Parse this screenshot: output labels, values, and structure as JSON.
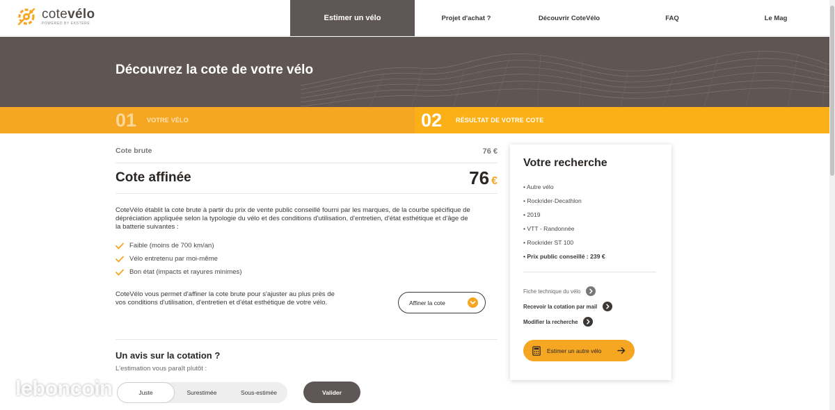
{
  "brand": {
    "name_light": "cote",
    "name_bold": "vélo",
    "powered_by": "powered by ekstere"
  },
  "nav": {
    "items": [
      {
        "label": "Estimer un vélo",
        "active": true
      },
      {
        "label": "Projet d'achat ?",
        "active": false
      },
      {
        "label": "Découvrir CoteVélo",
        "active": false
      },
      {
        "label": "FAQ",
        "active": false
      },
      {
        "label": "Le Mag",
        "active": false
      }
    ]
  },
  "hero": {
    "title": "Découvrez la cote de votre vélo"
  },
  "steps": [
    {
      "number": "01",
      "label": "VOTRE VÉLO"
    },
    {
      "number": "02",
      "label": "RÉSULTAT DE VOTRE COTE"
    }
  ],
  "result": {
    "brute_label": "Cote brute",
    "brute_value": "76 €",
    "affinee_label": "Cote affinée",
    "affinee_value": "76",
    "currency": "€",
    "description": "CoteVélo établit la cote brute à partir du prix de vente public conseillé fourni par les marques, de la courbe spécifique de dépréciation appliquée selon la typologie du vélo et des conditions d'utilisation, d'entretien, d'état esthétique et d'âge de la batterie suivantes :",
    "conditions": [
      "Faible (moins de 700 km/an)",
      "Vélo entretenu par moi-même",
      "Bon état (impacts et rayures minimes)"
    ],
    "affiner_text": "CoteVélo vous permet d'affiner la cote brute pour s'ajuster au plus près de vos conditions d'utilisation, d'entretien et d'état esthétique de votre vélo.",
    "affiner_button": "Affiner la cote"
  },
  "avis": {
    "title": "Un avis sur la cotation ?",
    "subtitle": "L'estimation vous paraît plutôt :",
    "options": [
      "Juste",
      "Surestimée",
      "Sous-estimée"
    ],
    "selected": "Juste",
    "submit": "Valider"
  },
  "search": {
    "title": "Votre recherche",
    "items": [
      "• Autre vélo",
      "• Rockrider-Decathlon",
      "• 2019",
      "• VTT - Randonnée",
      "• Rockrider ST 100",
      "• Prix public conseillé : 239 €"
    ],
    "links": [
      "Fiche technique du vélo",
      "Recevoir la cotation par mail",
      "Modifier la recherche"
    ],
    "cta": "Estimer un autre vélo"
  },
  "watermark": "leboncoin",
  "colors": {
    "accent": "#f5a623",
    "dark": "#5e5755",
    "hero_bg": "#5f5653"
  }
}
